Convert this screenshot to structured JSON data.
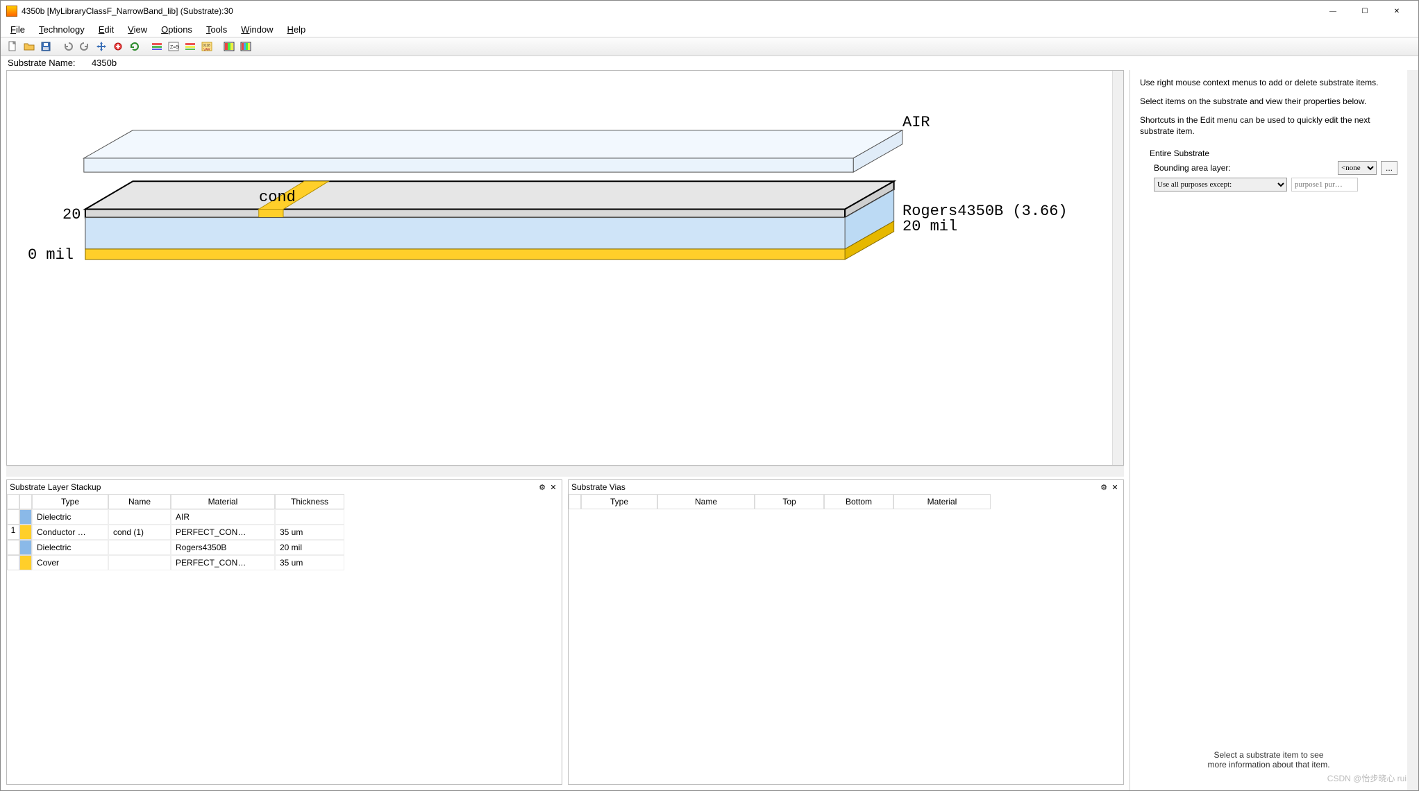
{
  "window": {
    "title": "4350b [MyLibraryClassF_NarrowBand_lib] (Substrate):30",
    "btn_min": "—",
    "btn_max": "☐",
    "btn_close": "✕"
  },
  "menu": {
    "file": "File",
    "tech": "Technology",
    "edit": "Edit",
    "view": "View",
    "options": "Options",
    "tools": "Tools",
    "window": "Window",
    "help": "Help"
  },
  "substrate": {
    "label": "Substrate Name:",
    "value": "4350b"
  },
  "viewer": {
    "air": "AIR",
    "cond": "cond",
    "y20": "20",
    "y0": "0 mil",
    "mat": "Rogers4350B (3.66)",
    "thk": "20 mil"
  },
  "stack": {
    "title": "Substrate Layer Stackup",
    "headers": {
      "type": "Type",
      "name": "Name",
      "material": "Material",
      "thickness": "Thickness"
    },
    "rows": [
      {
        "idx": "",
        "color": "sw-blue",
        "type": "Dielectric",
        "name": "",
        "material": "AIR",
        "thickness": ""
      },
      {
        "idx": "1",
        "color": "sw-yel",
        "type": "Conductor …",
        "name": "cond (1)",
        "material": "PERFECT_CON…",
        "thickness": "35 um"
      },
      {
        "idx": "",
        "color": "sw-blue",
        "type": "Dielectric",
        "name": "",
        "material": "Rogers4350B",
        "thickness": "20 mil"
      },
      {
        "idx": "",
        "color": "sw-yel",
        "type": "Cover",
        "name": "",
        "material": "PERFECT_CON…",
        "thickness": "35 um"
      }
    ]
  },
  "vias": {
    "title": "Substrate Vias",
    "headers": {
      "type": "Type",
      "name": "Name",
      "top": "Top",
      "bottom": "Bottom",
      "material": "Material"
    }
  },
  "right": {
    "help1": "Use right mouse context menus to add or delete substrate items.",
    "help2": "Select items on the substrate and view their properties below.",
    "help3": "Shortcuts in the Edit menu can be used to quickly edit the next substrate item.",
    "entire": "Entire Substrate",
    "bal": "Bounding area layer:",
    "bal_val": "<none",
    "dots": "...",
    "use_label": "Use all purposes except:",
    "purp_ph": "purpose1 pur…",
    "hint1": "Select a substrate item to see",
    "hint2": "more information about that item."
  },
  "watermark": "CSDN @怡步晓心 rui",
  "icons": {
    "gear": "⚙",
    "close": "✕"
  }
}
